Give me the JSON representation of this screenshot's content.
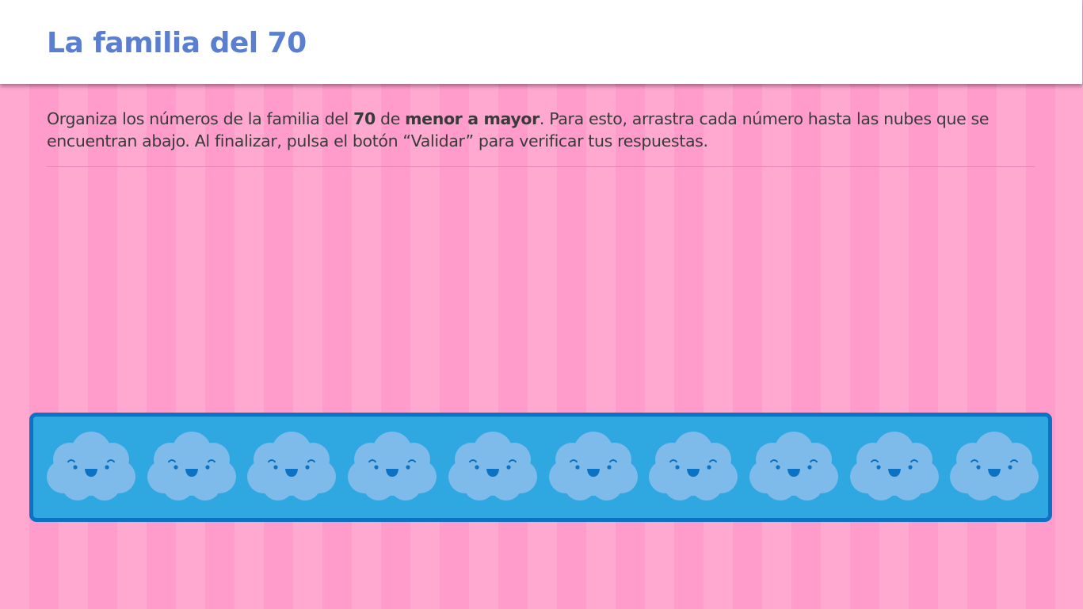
{
  "header": {
    "title": "La familia del 70"
  },
  "instructions": {
    "part1": "Organiza los números de la familia del ",
    "bold_number": "70",
    "part2": " de ",
    "bold_order": "menor a mayor",
    "part3": ". Para esto, arrastra cada número hasta las nubes que se encuentran abajo. Al finalizar, pulsa el botón “Validar” para verificar tus respuestas."
  },
  "drop_zone": {
    "slot_count": 10,
    "icon": "smiling-cloud-icon"
  },
  "colors": {
    "stripe_light": "#ffa9d1",
    "stripe_dark": "#ff9ccb",
    "title": "#5b7fd0",
    "panel_fill": "#2fa7e0",
    "panel_border": "#0b72c4",
    "cloud": "#7ebbea"
  }
}
